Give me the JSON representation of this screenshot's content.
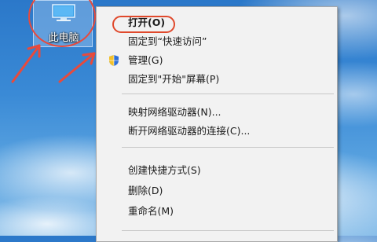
{
  "desktop": {
    "icon_label": "此电脑",
    "icon_name": "computer-icon"
  },
  "context_menu": {
    "items": [
      {
        "label": "打开(O)",
        "bold": true,
        "highlighted": true
      },
      {
        "label": "固定到“快速访问”"
      },
      {
        "label": "管理(G)",
        "icon": "uac-shield-icon"
      },
      {
        "label": "固定到\"开始\"屏幕(P)"
      },
      {
        "label": "映射网络驱动器(N)..."
      },
      {
        "label": "断开网络驱动器的连接(C)..."
      },
      {
        "label": "创建快捷方式(S)"
      },
      {
        "label": "删除(D)"
      },
      {
        "label": "重命名(M)"
      }
    ]
  },
  "annotation_colors": {
    "highlight": "#e0492c",
    "arrow": "#e84a3c"
  }
}
